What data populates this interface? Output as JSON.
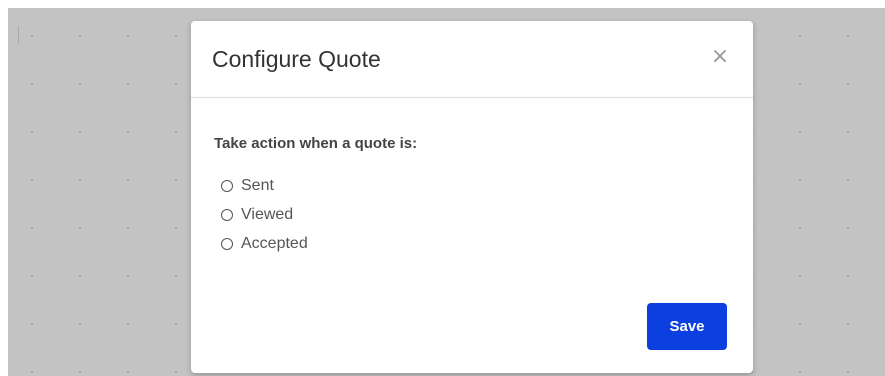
{
  "modal": {
    "title": "Configure Quote",
    "close_label": "×",
    "prompt": "Take action when a quote is:",
    "options": [
      {
        "label": "Sent",
        "selected": false
      },
      {
        "label": "Viewed",
        "selected": false
      },
      {
        "label": "Accepted",
        "selected": false
      }
    ],
    "save_label": "Save"
  },
  "colors": {
    "backdrop": "#c3c3c3",
    "primary_button": "#0b3fe0",
    "title_text": "#333333"
  },
  "icons": {
    "close": "close-icon",
    "radio": "radio-unchecked-icon"
  }
}
